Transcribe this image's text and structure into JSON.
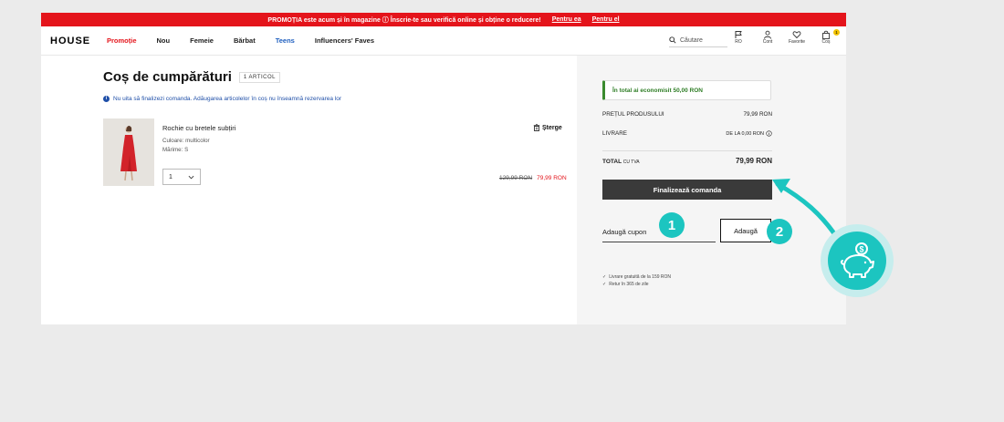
{
  "promo_bar": {
    "text": "PROMOȚIA este acum și în magazine ⓘ Înscrie-te sau verifică online și obține o reducere!",
    "link_her": "Pentru ea",
    "link_him": "Pentru el"
  },
  "nav": {
    "logo": "HOUSE",
    "items": [
      "Promoție",
      "Nou",
      "Femeie",
      "Bărbat",
      "Teens",
      "Influencers' Faves"
    ],
    "search_placeholder": "Căutare",
    "icons": [
      {
        "label": "RO",
        "icon": "flag-icon"
      },
      {
        "label": "Cont",
        "icon": "user-icon"
      },
      {
        "label": "Favorite",
        "icon": "heart-icon"
      },
      {
        "label": "Coș",
        "icon": "bag-icon",
        "badge": "1"
      }
    ]
  },
  "cart": {
    "title": "Coș de cumpărături",
    "count": "1 ARTICOL",
    "info": "Nu uita să finalizezi comanda. Adăugarea articolelor în coș nu înseamnă rezervarea lor",
    "item": {
      "name": "Rochie cu bretele subțiri",
      "color": "Culoare: multicolor",
      "size": "Mărime: S",
      "quantity": "1",
      "delete": "Șterge",
      "old_price": "129,99 RON",
      "new_price": "79,99 RON"
    }
  },
  "summary": {
    "savings": "În total ai economisit 50,00 RON",
    "products_label": "PREȚUL PRODUSULUI",
    "products_value": "79,99 RON",
    "delivery_label": "LIVRARE",
    "delivery_value": "DE LA 0,00 RON",
    "total_label": "TOTAL",
    "total_sub": "CU TVA",
    "total_value": "79,99 RON",
    "checkout": "Finalizează comanda",
    "coupon_label": "Adaugă cupon",
    "coupon_button": "Adaugă",
    "perks": [
      "Livrare gratuită de la 159 RON",
      "Retur în 365 de zile"
    ]
  },
  "overlay": {
    "step1": "1",
    "step2": "2",
    "accent": "#1cc5c0"
  }
}
